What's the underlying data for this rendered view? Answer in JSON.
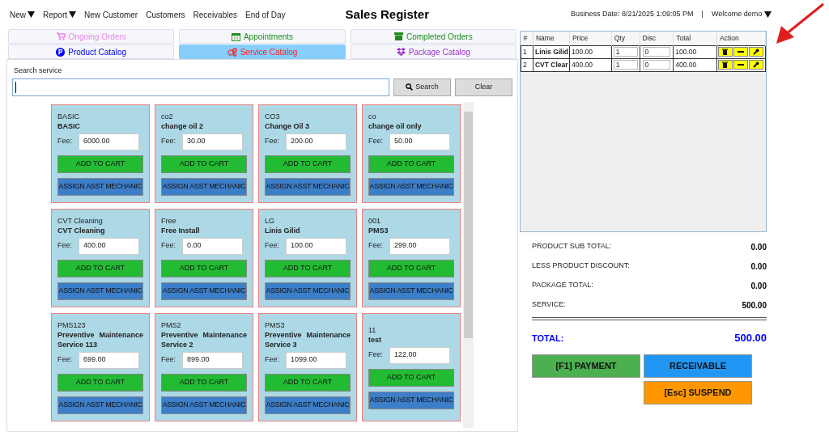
{
  "menu": [
    {
      "label": "New",
      "dropdown": true
    },
    {
      "label": "Report",
      "dropdown": true
    },
    {
      "label": "New Customer",
      "dropdown": false
    },
    {
      "label": "Customers",
      "dropdown": false
    },
    {
      "label": "Receivables",
      "dropdown": false
    },
    {
      "label": "End of Day",
      "dropdown": false
    }
  ],
  "title": "Sales Register",
  "business_date": "Business Date: 8/21/2025 1:09:05 PM",
  "separator": "|",
  "user_menu": {
    "label": "Welcome demo",
    "dropdown": true
  },
  "tabs": [
    {
      "label": "Ongoing Orders",
      "color": "#ee82ee",
      "selected": false
    },
    {
      "label": "Appointments",
      "color": "#228b22",
      "selected": false
    },
    {
      "label": "Completed Orders",
      "color": "#228b22",
      "selected": false
    },
    {
      "label": "Product Catalog",
      "color": "#0000ff",
      "selected": false
    },
    {
      "label": "Service Catalog",
      "color": "#ff2020",
      "selected": true
    },
    {
      "label": "Package Catalog",
      "color": "#9932cc",
      "selected": false
    }
  ],
  "search": {
    "label": "Search service",
    "button": "Search",
    "clear": "Clear"
  },
  "services": [
    {
      "code": "BASIC",
      "name": "BASIC",
      "fee_label": "Fee:",
      "fee": "6000.00",
      "add": "ADD TO CART",
      "assign": "ASSIGN ASST MECHANIC"
    },
    {
      "code": "co2",
      "name": "change oil 2",
      "fee_label": "Fee:",
      "fee": "30.00",
      "add": "ADD TO CART",
      "assign": "ASSIGN ASST MECHANIC"
    },
    {
      "code": "CO3",
      "name": "Change Oil 3",
      "fee_label": "Fee:",
      "fee": "200.00",
      "add": "ADD TO CART",
      "assign": "ASSIGN ASST MECHANIC"
    },
    {
      "code": "co",
      "name": "change oil only",
      "fee_label": "Fee:",
      "fee": "50.00",
      "add": "ADD TO CART",
      "assign": "ASSIGN ASST MECHANIC"
    },
    {
      "code": "CVT Cleaning",
      "name": "CVT Cleaning",
      "fee_label": "Fee:",
      "fee": "400.00",
      "add": "ADD TO CART",
      "assign": "ASSIGN ASST MECHANIC"
    },
    {
      "code": "Free",
      "name": "Free Install",
      "fee_label": "Fee:",
      "fee": "0.00",
      "add": "ADD TO CART",
      "assign": "ASSIGN ASST MECHANIC"
    },
    {
      "code": "LG",
      "name": "Linis Gilid",
      "fee_label": "Fee:",
      "fee": "100.00",
      "add": "ADD TO CART",
      "assign": "ASSIGN ASST MECHANIC"
    },
    {
      "code": "001",
      "name": "PMS3",
      "fee_label": "Fee:",
      "fee": "299.00",
      "add": "ADD TO CART",
      "assign": "ASSIGN ASST MECHANIC"
    },
    {
      "code": "PMS123",
      "name": "Preventive Maintenance Service 113",
      "fee_label": "Fee:",
      "fee": "699.00",
      "add": "ADD TO CART",
      "assign": "ASSIGN ASST MECHANIC"
    },
    {
      "code": "PMS2",
      "name": "Preventive Maintenance Service 2",
      "fee_label": "Fee:",
      "fee": "899.00",
      "add": "ADD TO CART",
      "assign": "ASSIGN ASST MECHANIC"
    },
    {
      "code": "PMS3",
      "name": "Preventive Maintenance Service 3",
      "fee_label": "Fee:",
      "fee": "1099.00",
      "add": "ADD TO CART",
      "assign": "ASSIGN ASST MECHANIC"
    },
    {
      "code": "11",
      "name": "test",
      "fee_label": "Fee:",
      "fee": "122.00",
      "add": "ADD TO CART",
      "assign": "ASSIGN ASST MECHANIC"
    }
  ],
  "cart": {
    "columns": [
      "#",
      "Name",
      "Price",
      "Qty",
      "Disc",
      "Total",
      "Action"
    ],
    "rows": [
      {
        "number": "1",
        "name": "Linis Gilid",
        "price": "100.00",
        "qty": "1",
        "disc": "0",
        "total": "100.00"
      },
      {
        "number": "2",
        "name": "CVT Clear",
        "price": "400.00",
        "qty": "1",
        "disc": "0",
        "total": "400.00"
      }
    ]
  },
  "summary": {
    "lines": [
      {
        "label": "PRODUCT SUB TOTAL:",
        "value": "0.00"
      },
      {
        "label": "LESS PRODUCT DISCOUNT:",
        "value": "0.00"
      },
      {
        "label": "PACKAGE TOTAL:",
        "value": "0.00"
      },
      {
        "label": "SERVICE:",
        "value": "500.00"
      }
    ],
    "total": {
      "label": "TOTAL:",
      "value": "500.00"
    },
    "buttons": [
      {
        "label": "[F1] PAYMENT",
        "color": "#4caf50"
      },
      {
        "label": "RECEIVABLE",
        "color": "#2196f3"
      },
      {
        "label": "[Esc] SUSPEND",
        "color": "#ff9800"
      }
    ]
  }
}
